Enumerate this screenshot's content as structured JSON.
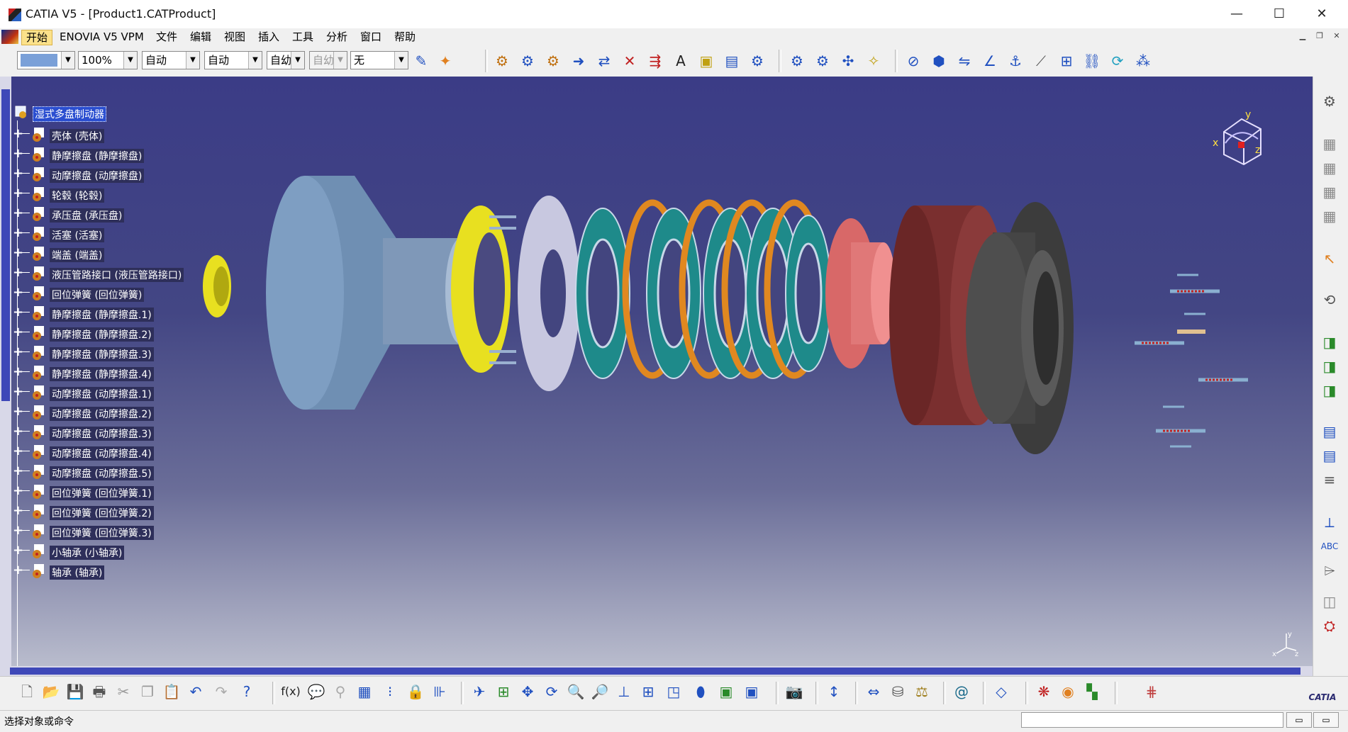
{
  "window": {
    "title": "CATIA V5 - [Product1.CATProduct]",
    "minimize_icon": "—",
    "maximize_icon": "☐",
    "close_icon": "✕"
  },
  "menu": {
    "items": [
      "开始",
      "ENOVIA V5 VPM",
      "文件",
      "编辑",
      "视图",
      "插入",
      "工具",
      "分析",
      "窗口",
      "帮助"
    ],
    "active": "开始"
  },
  "toolbar": {
    "color_swatch": "#7aa0d8",
    "zoom": "100%",
    "linetype": "自动",
    "thickness": "自动",
    "layer_short": "自幼",
    "layer_disabled": "自幼",
    "layer": "无"
  },
  "tree": {
    "root": "湿式多盘制动器",
    "items": [
      "壳体 (壳体)",
      "静摩擦盘 (静摩擦盘)",
      "动摩擦盘 (动摩擦盘)",
      "轮毂 (轮毂)",
      "承压盘 (承压盘)",
      "活塞 (活塞)",
      "端盖 (端盖)",
      "液压管路接口 (液压管路接口)",
      "回位弹簧 (回位弹簧)",
      "静摩擦盘 (静摩擦盘.1)",
      "静摩擦盘 (静摩擦盘.2)",
      "静摩擦盘 (静摩擦盘.3)",
      "静摩擦盘 (静摩擦盘.4)",
      "动摩擦盘 (动摩擦盘.1)",
      "动摩擦盘 (动摩擦盘.2)",
      "动摩擦盘 (动摩擦盘.3)",
      "动摩擦盘 (动摩擦盘.4)",
      "动摩擦盘 (动摩擦盘.5)",
      "回位弹簧 (回位弹簧.1)",
      "回位弹簧 (回位弹簧.2)",
      "回位弹簧 (回位弹簧.3)",
      "小轴承 (小轴承)",
      "轴承 (轴承)"
    ]
  },
  "compass": {
    "x": "x",
    "y": "y",
    "z": "z"
  },
  "status": {
    "prompt": "选择对象或命令"
  },
  "logo": {
    "brand": "CATIA"
  },
  "colors": {
    "viewport_top": "#3b3c86",
    "viewport_bottom": "#b9bccd",
    "selection": "#2a4ed0",
    "scrollbar": "#3e48b8"
  }
}
